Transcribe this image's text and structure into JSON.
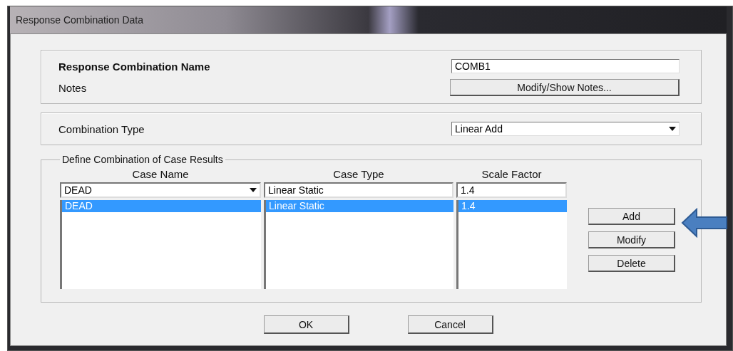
{
  "window": {
    "title": "Response Combination Data"
  },
  "name_section": {
    "name_label": "Response Combination Name",
    "name_value": "COMB1",
    "notes_label": "Notes",
    "notes_button": "Modify/Show Notes..."
  },
  "type_section": {
    "label": "Combination Type",
    "value": "Linear Add"
  },
  "cases": {
    "title": "Define Combination of Case Results",
    "columns": [
      "Case Name",
      "Case Type",
      "Scale Factor"
    ],
    "entry": {
      "case_name": "DEAD",
      "case_type": "Linear Static",
      "scale_factor": "1.4"
    },
    "rows": [
      {
        "case_name": "DEAD",
        "case_type": "Linear Static",
        "scale_factor": "1.4",
        "selected": true
      }
    ],
    "buttons": [
      "Add",
      "Modify",
      "Delete"
    ]
  },
  "buttons": [
    "OK",
    "Cancel"
  ]
}
